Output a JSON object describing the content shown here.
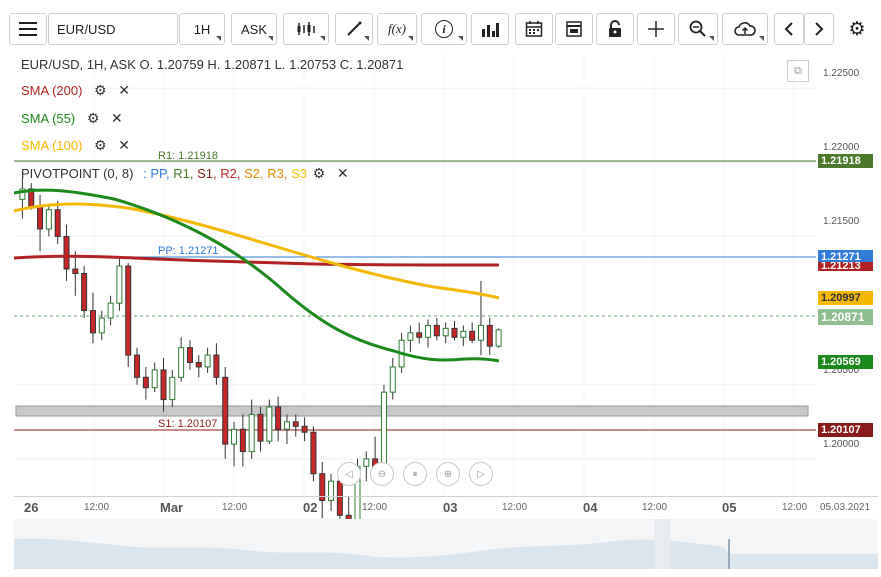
{
  "toolbar": {
    "symbol": "EUR/USD",
    "interval": "1H",
    "price_type": "ASK",
    "buttons": [
      "menu-icon",
      "candles-icon",
      "draw-icon",
      "fx-icon",
      "info-icon",
      "bars-icon",
      "calendar-icon",
      "layout-icon",
      "lock-icon",
      "crosshair-icon",
      "zoom-icon",
      "cloud-icon",
      "prev-icon",
      "next-icon",
      "gear-icon"
    ],
    "fx_label": "f(x)",
    "info_label": "i"
  },
  "legend": {
    "ohlc": "EUR/USD, 1H, ASK    O. 1.20759 H. 1.20871 L. 1.20753 C. 1.20871",
    "sma200": "SMA (200)",
    "sma55": "SMA (55)",
    "sma100": "SMA (100)",
    "pivot_name": "PIVOTPOINT (0, 8)",
    "pivot_sep": ":",
    "pivot_pp": "PP,",
    "pivot_r1": "R1,",
    "pivot_s1": "S1,",
    "pivot_r2": "R2,",
    "pivot_s2": "S2,",
    "pivot_r3": "R3,",
    "pivot_s3": "S3"
  },
  "colors": {
    "sma200": "#b22222",
    "sma55": "#1a8a1a",
    "sma100": "#f5b800",
    "pp": "#2f7bd6",
    "r1": "#4a7a2a",
    "s1": "#8b1a1a",
    "up": "#2e7d32",
    "down": "#c62828"
  },
  "levels": {
    "r1_label": "R1: 1.21918",
    "pp_label": "PP: 1.21271",
    "s1_label": "S1: 1.20107"
  },
  "price_axis": {
    "ticks": [
      "1.22500",
      "1.22000",
      "1.21500",
      "1.20500",
      "1.20000"
    ],
    "tag_r1": "1.21918",
    "tag_pp": "1.21271",
    "tag_sma200": "1.21213",
    "tag_sma100": "1.20997",
    "tag_last": "1.20871",
    "tag_sma55": "1.20569",
    "tag_s1": "1.20107"
  },
  "time_axis": {
    "labels": [
      "26",
      "12:00",
      "Mar",
      "12:00",
      "02",
      "12:00",
      "03",
      "12:00",
      "04",
      "12:00",
      "05",
      "12:00"
    ],
    "date_stamp": "05.03.2021"
  },
  "chart_data": {
    "type": "candlestick",
    "instrument": "EUR/USD",
    "interval": "1H",
    "last_close": 1.20871,
    "ohlc": {
      "open": 1.20759,
      "high": 1.20871,
      "low": 1.20753,
      "close": 1.20871
    },
    "pivots": {
      "R1": 1.21918,
      "PP": 1.21271,
      "S1": 1.20107
    },
    "indicators": {
      "SMA200": 1.21213,
      "SMA100": 1.20997,
      "SMA55": 1.20569
    },
    "ylim": [
      1.1975,
      1.2275
    ],
    "y_ticks": [
      1.225,
      1.22,
      1.215,
      1.205,
      1.2
    ],
    "candles": [
      [
        1.2175,
        1.219,
        1.2162,
        1.2182
      ],
      [
        1.2182,
        1.2186,
        1.2168,
        1.217
      ],
      [
        1.217,
        1.2178,
        1.214,
        1.2155
      ],
      [
        1.2155,
        1.2172,
        1.215,
        1.2168
      ],
      [
        1.2168,
        1.2174,
        1.2145,
        1.215
      ],
      [
        1.215,
        1.2158,
        1.212,
        1.2128
      ],
      [
        1.2128,
        1.214,
        1.211,
        1.2125
      ],
      [
        1.2125,
        1.213,
        1.2095,
        1.21
      ],
      [
        1.21,
        1.2112,
        1.2078,
        1.2085
      ],
      [
        1.2085,
        1.21,
        1.208,
        1.2095
      ],
      [
        1.2095,
        1.211,
        1.209,
        1.2105
      ],
      [
        1.2105,
        1.2135,
        1.21,
        1.213
      ],
      [
        1.213,
        1.2132,
        1.2062,
        1.207
      ],
      [
        1.207,
        1.2075,
        1.205,
        1.2055
      ],
      [
        1.2055,
        1.2062,
        1.204,
        1.2048
      ],
      [
        1.2048,
        1.2065,
        1.2045,
        1.206
      ],
      [
        1.206,
        1.2068,
        1.2032,
        1.204
      ],
      [
        1.204,
        1.206,
        1.2035,
        1.2055
      ],
      [
        1.2055,
        1.2082,
        1.2052,
        1.2075
      ],
      [
        1.2075,
        1.208,
        1.206,
        1.2065
      ],
      [
        1.2065,
        1.207,
        1.2055,
        1.2062
      ],
      [
        1.2062,
        1.2075,
        1.2058,
        1.207
      ],
      [
        1.207,
        1.2078,
        1.205,
        1.2055
      ],
      [
        1.2055,
        1.2062,
        1.2,
        1.201
      ],
      [
        1.201,
        1.2025,
        1.1995,
        1.202
      ],
      [
        1.202,
        1.203,
        1.1995,
        1.2005
      ],
      [
        1.2005,
        1.204,
        1.2,
        1.203
      ],
      [
        1.203,
        1.2035,
        1.2005,
        1.2012
      ],
      [
        1.2012,
        1.204,
        1.201,
        1.2035
      ],
      [
        1.2035,
        1.2042,
        1.2012,
        1.202
      ],
      [
        1.202,
        1.203,
        1.201,
        1.2025
      ],
      [
        1.2025,
        1.203,
        1.2015,
        1.2022
      ],
      [
        1.2022,
        1.2028,
        1.2012,
        1.2018
      ],
      [
        1.2018,
        1.2022,
        1.1985,
        1.199
      ],
      [
        1.199,
        1.1998,
        1.196,
        1.1972
      ],
      [
        1.1972,
        1.199,
        1.1965,
        1.1985
      ],
      [
        1.1985,
        1.199,
        1.1955,
        1.1962
      ],
      [
        1.1962,
        1.1975,
        1.194,
        1.195
      ],
      [
        1.195,
        1.2,
        1.1945,
        1.1995
      ],
      [
        1.1995,
        1.2005,
        1.1985,
        1.2
      ],
      [
        1.2,
        1.2015,
        1.199,
        1.1995
      ],
      [
        1.1995,
        1.205,
        1.199,
        1.2045
      ],
      [
        1.2045,
        1.2068,
        1.204,
        1.2062
      ],
      [
        1.2062,
        1.2085,
        1.2058,
        1.208
      ],
      [
        1.208,
        1.209,
        1.2072,
        1.2085
      ],
      [
        1.2085,
        1.2092,
        1.2078,
        1.2082
      ],
      [
        1.2082,
        1.2094,
        1.2075,
        1.209
      ],
      [
        1.209,
        1.2095,
        1.208,
        1.2083
      ],
      [
        1.2083,
        1.2092,
        1.2078,
        1.2088
      ],
      [
        1.2088,
        1.2093,
        1.208,
        1.2082
      ],
      [
        1.2082,
        1.209,
        1.2076,
        1.2086
      ],
      [
        1.2086,
        1.2092,
        1.2078,
        1.208
      ],
      [
        1.208,
        1.212,
        1.207,
        1.209
      ],
      [
        1.209,
        1.2095,
        1.207,
        1.2076
      ],
      [
        1.2076,
        1.2088,
        1.2075,
        1.2087
      ]
    ]
  },
  "nav_buttons": [
    "nav-prev-icon",
    "zoom-out-icon",
    "fit-icon",
    "zoom-in-icon",
    "nav-next-icon"
  ]
}
